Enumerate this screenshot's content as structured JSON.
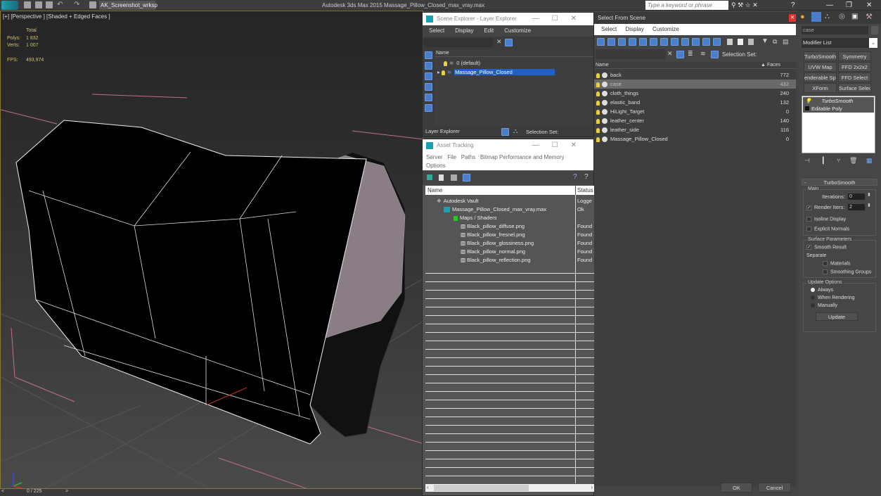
{
  "app": {
    "title": "Autodesk 3ds Max  2015    Massage_Pillow_Closed_max_vray.max",
    "workspace": "AK_Screenshot_wrksp",
    "search_placeholder": "Type a keyword or phrase"
  },
  "viewport": {
    "label": "[+] [Perspective ] [Shaded + Edged Faces ]",
    "stats": {
      "header": "Total",
      "polys_label": "Polys:",
      "polys_value": "1 832",
      "verts_label": "Verts:",
      "verts_value": "1 007",
      "fps_label": "FPS:",
      "fps_value": "493,974"
    },
    "accent_color": "#8a7a3a"
  },
  "timeline": {
    "prev": "<",
    "frame": "0 / 225",
    "next": ">"
  },
  "scene_explorer": {
    "title": "Scene Explorer - Layer Explorer",
    "menu": [
      "Select",
      "Display",
      "Edit",
      "Customize"
    ],
    "column": "Name",
    "layers": [
      {
        "name": "0 (default)",
        "selected": false
      },
      {
        "name": "Massage_Pillow_Closed",
        "selected": true
      }
    ],
    "footer_dropdown": "Layer Explorer",
    "selection_set_label": "Selection Set:"
  },
  "asset_tracking": {
    "title": "Asset Tracking",
    "menu": [
      "Server",
      "File",
      "Paths",
      "Bitmap Performance and Memory",
      "Options"
    ],
    "columns": [
      "Name",
      "Status"
    ],
    "rows": [
      {
        "name": "Autodesk Vault",
        "status": "Logge",
        "indent": 1
      },
      {
        "name": "Massage_Pillow_Closed_max_vray.max",
        "status": "Ok",
        "indent": 2
      },
      {
        "name": "Maps / Shaders",
        "status": "",
        "indent": 3
      },
      {
        "name": "Black_pillow_diffuse.png",
        "status": "Found",
        "indent": 4
      },
      {
        "name": "Black_pillow_fresnel.png",
        "status": "Found",
        "indent": 4
      },
      {
        "name": "Black_pillow_glossiness.png",
        "status": "Found",
        "indent": 4
      },
      {
        "name": "Black_pillow_normal.png",
        "status": "Found",
        "indent": 4
      },
      {
        "name": "Black_pillow_reflection.png",
        "status": "Found",
        "indent": 4
      }
    ]
  },
  "select_from_scene": {
    "title": "Select From Scene",
    "menu": [
      "Select",
      "Display",
      "Customize"
    ],
    "selection_set_label": "Selection Set:",
    "columns": [
      "Name",
      "Faces"
    ],
    "objects": [
      {
        "name": "back",
        "faces": "772",
        "selected": false
      },
      {
        "name": "case",
        "faces": "432",
        "selected": true
      },
      {
        "name": "cloth_things",
        "faces": "240",
        "selected": false
      },
      {
        "name": "elastic_band",
        "faces": "132",
        "selected": false
      },
      {
        "name": "HiLight_Target",
        "faces": "0",
        "selected": false
      },
      {
        "name": "leather_center",
        "faces": "140",
        "selected": false
      },
      {
        "name": "leather_side",
        "faces": "116",
        "selected": false
      },
      {
        "name": "Massage_Pillow_Closed",
        "faces": "0",
        "selected": false
      }
    ],
    "ok_label": "OK",
    "cancel_label": "Cancel"
  },
  "command_panel": {
    "object_name": "case",
    "modifier_list": "Modifier List",
    "modifier_buttons": [
      "TurboSmooth",
      "Symmetry",
      "UVW Map",
      "FFD 2x2x2",
      "enderable Spli",
      "FFD Select",
      "XForm",
      "Surface Select"
    ],
    "stack": [
      "TurboSmooth",
      "Editable Poly"
    ],
    "rollout_title": "TurboSmooth",
    "main_group": "Main",
    "iterations_label": "Iterations:",
    "iterations_value": "0",
    "render_iters_label": "Render Iters:",
    "render_iters_value": "2",
    "render_iters_checked": true,
    "isoline_label": "Isoline Display",
    "explicit_normals_label": "Explicit Normals",
    "surface_group": "Surface Parameters",
    "smooth_result_label": "Smooth Result",
    "separate_label": "Separate",
    "materials_label": "Materials",
    "smoothing_groups_label": "Smoothing Groups",
    "update_group": "Update Options",
    "update_options": [
      "Always",
      "When Rendering",
      "Manually"
    ],
    "update_selected": "Always",
    "update_button": "Update"
  }
}
